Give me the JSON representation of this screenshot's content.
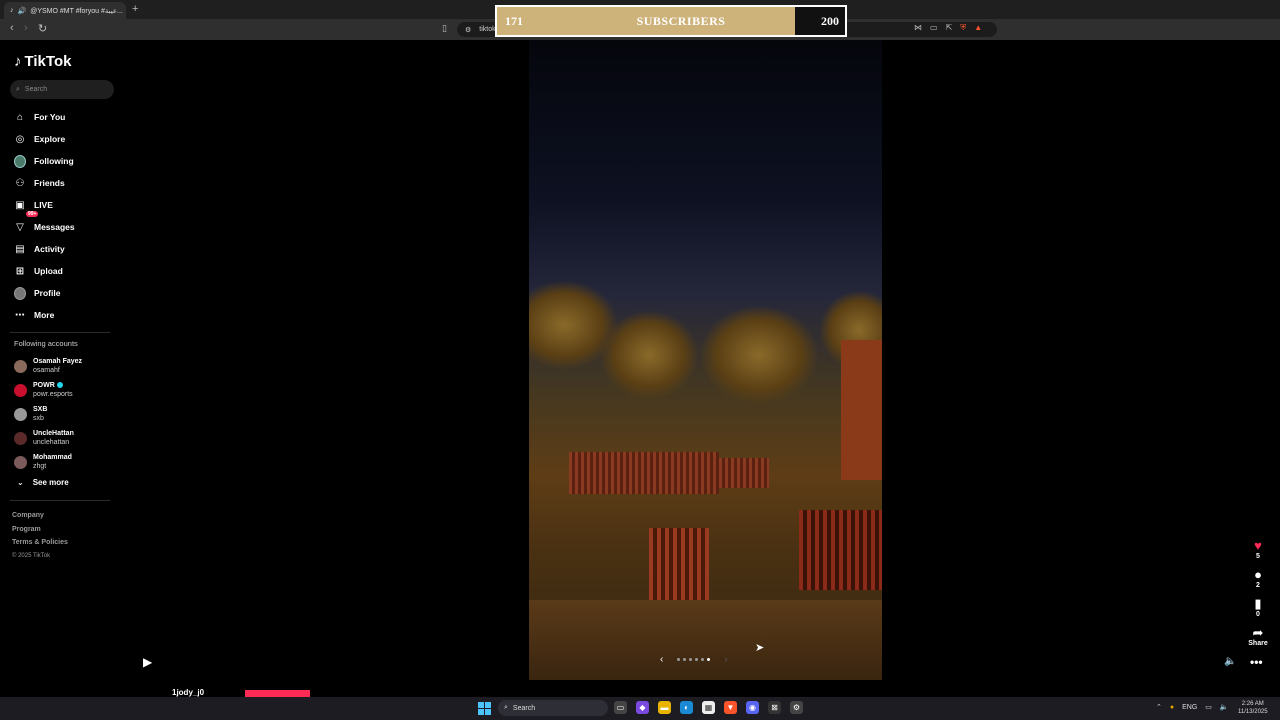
{
  "browser": {
    "tab_title": "@YSMO #MT #foryou #عيبة...",
    "url": "tiktok"
  },
  "overlay": {
    "current": "171",
    "label": "SUBSCRIBERS",
    "goal": "200"
  },
  "sidebar": {
    "logo": "TikTok",
    "search_placeholder": "Search",
    "nav": [
      {
        "label": "For You",
        "icon": "home-icon"
      },
      {
        "label": "Explore",
        "icon": "compass-icon"
      },
      {
        "label": "Following",
        "icon": "following-avatar-icon"
      },
      {
        "label": "Friends",
        "icon": "friends-icon"
      },
      {
        "label": "LIVE",
        "icon": "live-icon"
      },
      {
        "label": "Messages",
        "icon": "messages-icon",
        "badge": "99+"
      },
      {
        "label": "Activity",
        "icon": "activity-icon"
      },
      {
        "label": "Upload",
        "icon": "upload-icon"
      },
      {
        "label": "Profile",
        "icon": "profile-avatar-icon"
      },
      {
        "label": "More",
        "icon": "more-icon"
      }
    ],
    "following_title": "Following accounts",
    "accounts": [
      {
        "name": "Osamah Fayez",
        "handle": "osamahf"
      },
      {
        "name": "POWR",
        "handle": "powr.esports",
        "verified": true
      },
      {
        "name": "SXB",
        "handle": "sxb"
      },
      {
        "name": "UncleHattan",
        "handle": "unclehattan"
      },
      {
        "name": "Mohammad",
        "handle": "zhgt"
      }
    ],
    "see_more": "See more",
    "footer": {
      "company": "Company",
      "program": "Program",
      "terms": "Terms & Policies",
      "copyright": "© 2025 TikTok"
    }
  },
  "actions": {
    "likes": "5",
    "comments": "2",
    "saves": "0",
    "share": "Share"
  },
  "carousel": {
    "slides": 6,
    "current": 6
  },
  "bottom": {
    "username": "1jody_j0"
  },
  "taskbar": {
    "search": "Search",
    "lang": "ENG",
    "time": "2:26 AM",
    "date": "11/13/2025"
  }
}
